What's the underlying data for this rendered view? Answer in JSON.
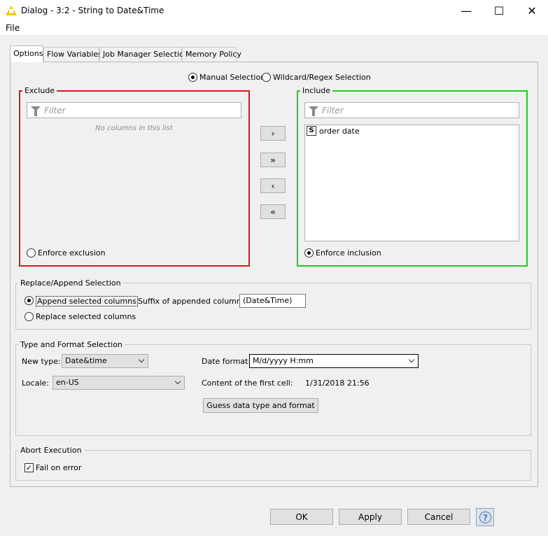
{
  "window": {
    "title": "Dialog - 3:2 - String to Date&Time",
    "minimize_glyph": "—",
    "maximize_glyph": "☐",
    "close_glyph": "✕"
  },
  "menu": {
    "file": "File"
  },
  "tabs": [
    {
      "label": "Options",
      "active": true
    },
    {
      "label": "Flow Variables",
      "active": false
    },
    {
      "label": "Job Manager Selection",
      "active": false
    },
    {
      "label": "Memory Policy",
      "active": false
    }
  ],
  "selection_mode": {
    "manual": "Manual Selection",
    "wildcard": "Wildcard/Regex Selection",
    "selected": "manual"
  },
  "exclude": {
    "legend": "Exclude",
    "border_color": "#e0141e",
    "filter_placeholder": "Filter",
    "empty_text": "No columns in this list",
    "enforce_label": "Enforce exclusion",
    "enforce_checked": false
  },
  "include": {
    "legend": "Include",
    "border_color": "#1ccf1c",
    "filter_placeholder": "Filter",
    "items": [
      {
        "type_badge": "S",
        "name": "order date"
      }
    ],
    "enforce_label": "Enforce inclusion",
    "enforce_checked": true
  },
  "move_buttons": {
    "add": "›",
    "add_all": "»",
    "remove": "‹",
    "remove_all": "«"
  },
  "replace_append": {
    "legend": "Replace/Append Selection",
    "append_label": "Append selected columns",
    "replace_label": "Replace selected columns",
    "selected": "append",
    "suffix_label": "Suffix of appended columns:",
    "suffix_value": "(Date&Time)"
  },
  "type_format": {
    "legend": "Type and Format Selection",
    "new_type_label": "New type:",
    "new_type_value": "Date&time",
    "date_format_label": "Date format:",
    "date_format_value": "M/d/yyyy H:mm",
    "locale_label": "Locale:",
    "locale_value": "en-US",
    "first_cell_label": "Content of the first cell:",
    "first_cell_value": "1/31/2018 21:56",
    "guess_button": "Guess data type and format"
  },
  "abort": {
    "legend": "Abort Execution",
    "fail_label": "Fail on error",
    "fail_checked": true,
    "check_glyph": "✓"
  },
  "footer": {
    "ok": "OK",
    "apply": "Apply",
    "cancel": "Cancel",
    "help_glyph": "?"
  }
}
